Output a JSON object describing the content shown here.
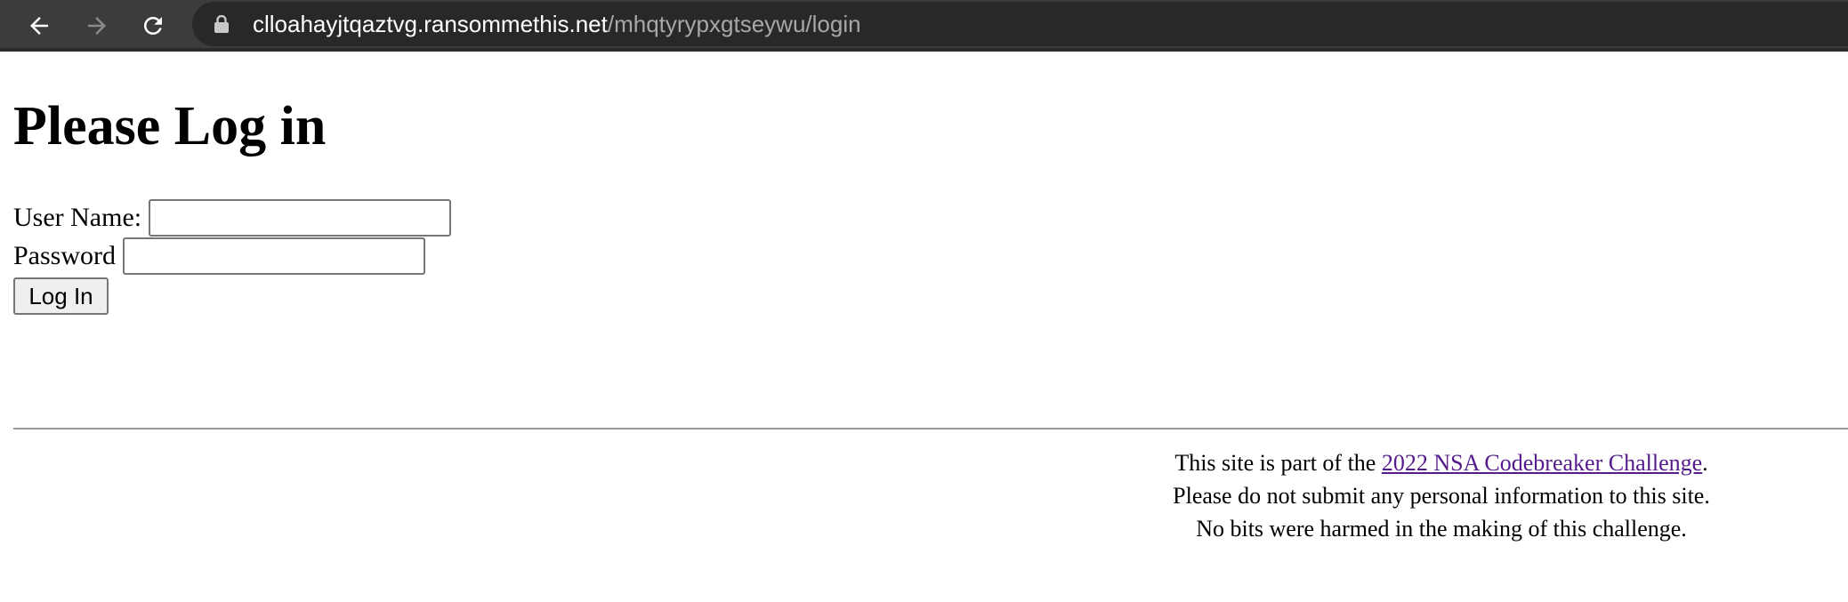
{
  "browser": {
    "url_host": "clloahayjtqaztvg.ransommethis.net",
    "url_path": "/mhqtyrypxgtseywu/login"
  },
  "page": {
    "title": "Please Log in",
    "username_label": "User Name:",
    "username_value": "",
    "password_label": "Password",
    "password_value": "",
    "login_button": "Log In"
  },
  "footer": {
    "line1_prefix": "This site is part of the ",
    "line1_link": "2022 NSA Codebreaker Challenge",
    "line1_suffix": ".",
    "line2": "Please do not submit any personal information to this site.",
    "line3": "No bits were harmed in the making of this challenge."
  },
  "colors": {
    "toolbar": "#3c3c3c",
    "omnibox": "#282828",
    "visited_link": "#551a8b"
  }
}
